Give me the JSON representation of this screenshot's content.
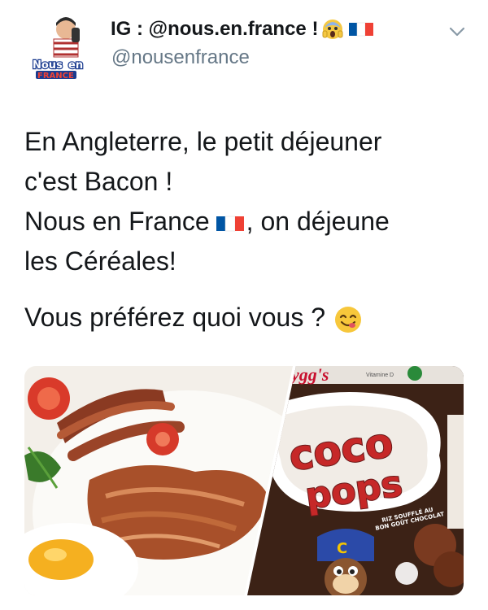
{
  "tweet": {
    "display_name": "IG : @nous.en.france !",
    "handle": "@nousenfrance",
    "avatar_text": [
      "Nous",
      "en",
      "FRANCE"
    ],
    "icons": {
      "name_emojis": [
        "face-screaming-emoji",
        "french-flag-emoji"
      ],
      "menu": "chevron-down-icon",
      "smiley": "face-savoring-food-emoji"
    },
    "text": {
      "line1": "En Angleterre, le petit déjeuner",
      "line2": "c'est Bacon !",
      "line3a": "Nous en France",
      "line3b": ", on déjeune",
      "line4": "les Céréales!",
      "line5": "Vous préférez quoi vous ?"
    },
    "media": {
      "box_brand": "ygg's",
      "box_badge": "Vitamine D",
      "product_line1": "coco",
      "product_line2": "pops",
      "box_tagline": [
        "RIZ SOUFFLÉ AU",
        "BON GOÛT CHOCOLAT"
      ]
    }
  },
  "colors": {
    "text": "#14171a",
    "secondary": "#657786",
    "flag_blue": "#0055a4",
    "flag_red": "#ef4135",
    "box_brown": "#4a2a1a",
    "box_red": "#d62a2a"
  }
}
